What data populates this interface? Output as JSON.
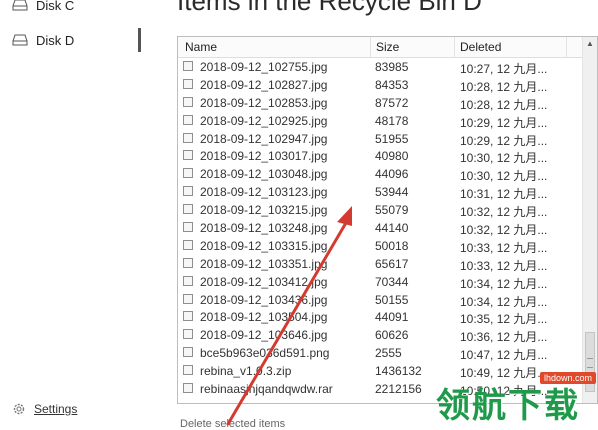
{
  "sidebar": {
    "items": [
      {
        "label": "Disk C"
      },
      {
        "label": "Disk D"
      }
    ],
    "settings_label": "Settings"
  },
  "title": "Items in the Recycle Bin D",
  "columns": {
    "name": "Name",
    "size": "Size",
    "deleted": "Deleted"
  },
  "rows": [
    {
      "name": "2018-09-12_102755.jpg",
      "size": "83985",
      "deleted": "10:27, 12 九月..."
    },
    {
      "name": "2018-09-12_102827.jpg",
      "size": "84353",
      "deleted": "10:28, 12 九月..."
    },
    {
      "name": "2018-09-12_102853.jpg",
      "size": "87572",
      "deleted": "10:28, 12 九月..."
    },
    {
      "name": "2018-09-12_102925.jpg",
      "size": "48178",
      "deleted": "10:29, 12 九月..."
    },
    {
      "name": "2018-09-12_102947.jpg",
      "size": "51955",
      "deleted": "10:29, 12 九月..."
    },
    {
      "name": "2018-09-12_103017.jpg",
      "size": "40980",
      "deleted": "10:30, 12 九月..."
    },
    {
      "name": "2018-09-12_103048.jpg",
      "size": "44096",
      "deleted": "10:30, 12 九月..."
    },
    {
      "name": "2018-09-12_103123.jpg",
      "size": "53944",
      "deleted": "10:31, 12 九月..."
    },
    {
      "name": "2018-09-12_103215.jpg",
      "size": "55079",
      "deleted": "10:32, 12 九月..."
    },
    {
      "name": "2018-09-12_103248.jpg",
      "size": "44140",
      "deleted": "10:32, 12 九月..."
    },
    {
      "name": "2018-09-12_103315.jpg",
      "size": "50018",
      "deleted": "10:33, 12 九月..."
    },
    {
      "name": "2018-09-12_103351.jpg",
      "size": "65617",
      "deleted": "10:33, 12 九月..."
    },
    {
      "name": "2018-09-12_103412.jpg",
      "size": "70344",
      "deleted": "10:34, 12 九月..."
    },
    {
      "name": "2018-09-12_103436.jpg",
      "size": "50155",
      "deleted": "10:34, 12 九月..."
    },
    {
      "name": "2018-09-12_103504.jpg",
      "size": "44091",
      "deleted": "10:35, 12 九月..."
    },
    {
      "name": "2018-09-12_103646.jpg",
      "size": "60626",
      "deleted": "10:36, 12 九月..."
    },
    {
      "name": "bce5b963e036d591.png",
      "size": "2555",
      "deleted": "10:47, 12 九月..."
    },
    {
      "name": "rebina_v1.0.3.zip",
      "size": "1436132",
      "deleted": "10:49, 12 九月..."
    },
    {
      "name": "rebinaasjnjqandqwdw.rar",
      "size": "2212156",
      "deleted": "10:50, 12 九月..."
    }
  ],
  "watermark": {
    "text": "领航下载",
    "badge": "lhdown.com"
  },
  "footer_partial": "Delete selected items",
  "colors": {
    "annotation_arrow": "#d33b30",
    "watermark_green": "#1f9a4a"
  }
}
